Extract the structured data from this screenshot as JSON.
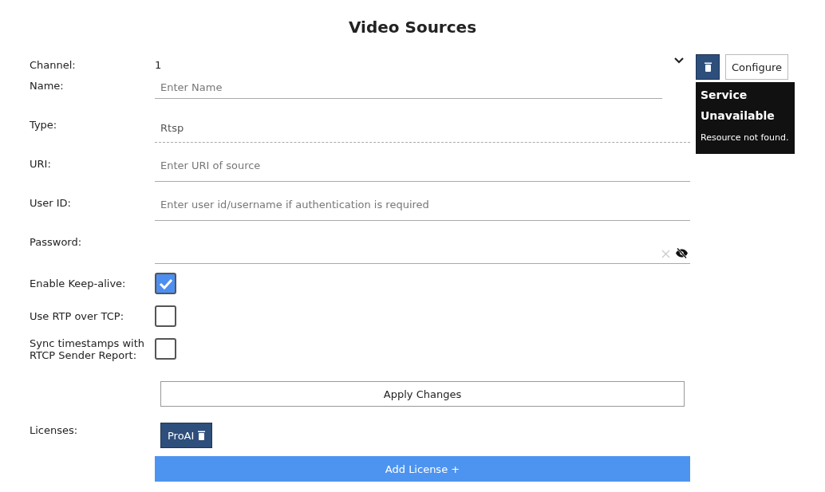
{
  "title": "Video Sources",
  "channel": {
    "label": "Channel:",
    "value": "1"
  },
  "fields": [
    {
      "kind": "text",
      "label": "Name:",
      "placeholder": "Enter Name"
    },
    {
      "kind": "select",
      "label": "Type:",
      "value": "Rtsp"
    },
    {
      "kind": "text",
      "label": "URI:",
      "placeholder": "Enter URI of source"
    },
    {
      "kind": "text",
      "label": "User ID:",
      "placeholder": "Enter user id/username if authentication is required"
    },
    {
      "kind": "password",
      "label": "Password:"
    }
  ],
  "options": [
    {
      "label": "Enable Keep-alive:",
      "checked": true
    },
    {
      "label": "Use RTP over TCP:",
      "checked": false
    },
    {
      "label": "Sync timestamps with RTCP Sender Report:",
      "checked": false
    }
  ],
  "apply_button": "Apply Changes",
  "licenses": {
    "label": "Licenses:",
    "items": [
      "ProAI"
    ],
    "add_button": "Add License +"
  },
  "configure_button": "Configure",
  "tooltip": {
    "title": "Service Unavailable",
    "message": "Resource not found."
  }
}
